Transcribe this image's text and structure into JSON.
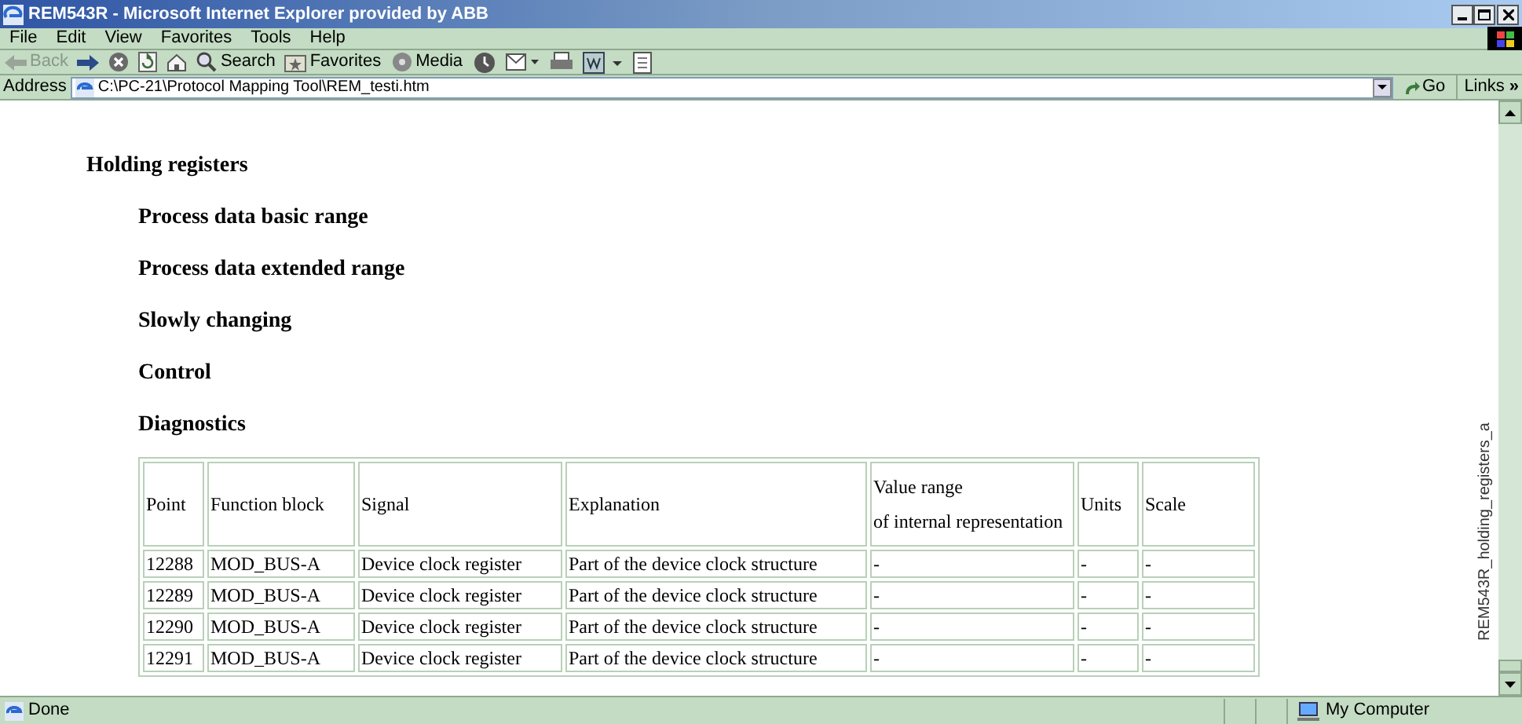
{
  "window": {
    "title": "REM543R - Microsoft Internet Explorer provided by ABB"
  },
  "menu": [
    "File",
    "Edit",
    "View",
    "Favorites",
    "Tools",
    "Help"
  ],
  "toolbar": [
    {
      "kind": "back",
      "label": "Back",
      "disabled": true
    },
    {
      "kind": "forward",
      "disabled": false
    },
    {
      "kind": "stop"
    },
    {
      "kind": "refresh"
    },
    {
      "kind": "home"
    },
    {
      "kind": "search",
      "label": "Search"
    },
    {
      "kind": "favorites",
      "label": "Favorites"
    },
    {
      "kind": "media",
      "label": "Media"
    },
    {
      "kind": "history"
    },
    {
      "kind": "mail"
    },
    {
      "kind": "print"
    },
    {
      "kind": "edit"
    },
    {
      "kind": "discuss"
    }
  ],
  "address_bar": {
    "label": "Address",
    "value": "C:\\PC-21\\Protocol Mapping Tool\\REM_testi.htm",
    "go": "Go",
    "links": "Links",
    "more": "»"
  },
  "page": {
    "heading": "Holding registers",
    "sections": [
      "Process data basic range",
      "Process data extended range",
      "Slowly changing",
      "Control",
      "Diagnostics"
    ],
    "table": {
      "columns": [
        "Point",
        "Function block",
        "Signal",
        "Explanation",
        "Value range\nof internal representation",
        "Units",
        "Scale"
      ],
      "rows": [
        [
          "12288",
          "MOD_BUS-A",
          "Device clock register",
          "Part of the device clock structure",
          "-",
          "-",
          "-"
        ],
        [
          "12289",
          "MOD_BUS-A",
          "Device clock register",
          "Part of the device clock structure",
          "-",
          "-",
          "-"
        ],
        [
          "12290",
          "MOD_BUS-A",
          "Device clock register",
          "Part of the device clock structure",
          "-",
          "-",
          "-"
        ],
        [
          "12291",
          "MOD_BUS-A",
          "Device clock register",
          "Part of the device clock structure",
          "-",
          "-",
          "-"
        ]
      ]
    },
    "side_label": "REM543R_holding_registers_a"
  },
  "status_bar": {
    "text": "Done",
    "zone": "My Computer"
  }
}
